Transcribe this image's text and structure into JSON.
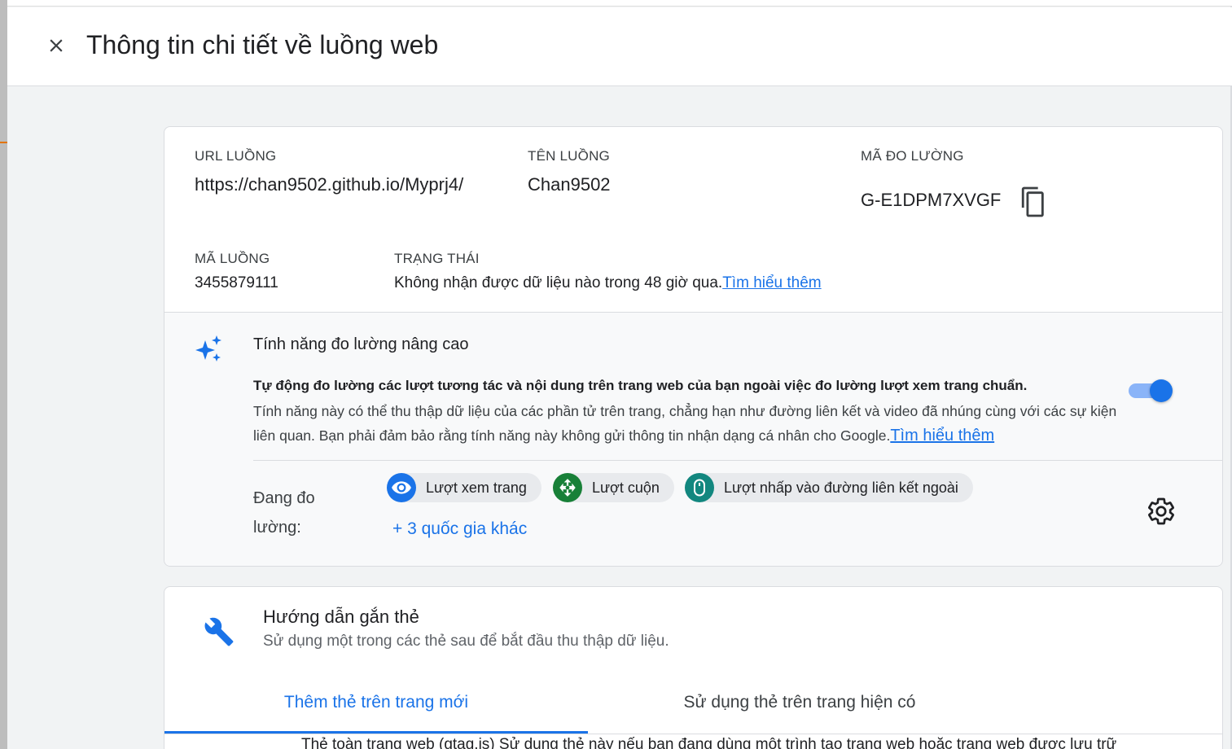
{
  "header": {
    "title": "Thông tin chi tiết về luồng web",
    "close_icon": "close-icon"
  },
  "stream_details": {
    "url_label": "URL LUỒNG",
    "url_value": "https://chan9502.github.io/Myprj4/",
    "name_label": "TÊN LUỒNG",
    "name_value": "Chan9502",
    "measurement_id_label": "MÃ ĐO LƯỜNG",
    "measurement_id_value": "G-E1DPM7XVGF",
    "stream_id_label": "MÃ LUỒNG",
    "stream_id_value": "3455879111",
    "status_label": "TRẠNG THÁI",
    "status_value": "Không nhận được dữ liệu nào trong 48 giờ qua.",
    "status_link": "Tìm hiểu thêm"
  },
  "enhanced_measurement": {
    "icon": "sparkle-icon",
    "title": "Tính năng đo lường nâng cao",
    "bold_text": "Tự động đo lường các lượt tương tác và nội dung trên trang web của bạn ngoài việc đo lường lượt xem trang chuẩn.",
    "description": "Tính năng này có thể thu thập dữ liệu của các phần tử trên trang, chẳng hạn như đường liên kết và video đã nhúng cùng với các sự kiện liên quan. Bạn phải đảm bảo rằng tính năng này không gửi thông tin nhận dạng cá nhân cho Google.",
    "learn_more": "Tìm hiểu thêm",
    "toggle_on": true,
    "measuring_label": "Đang đo lường:",
    "chips": [
      {
        "label": "Lượt xem trang",
        "icon": "eye-icon",
        "color": "#1a73e8"
      },
      {
        "label": "Lượt cuộn",
        "icon": "scroll-arrows-icon",
        "color": "#188038"
      },
      {
        "label": "Lượt nhấp vào đường liên kết ngoài",
        "icon": "mouse-icon",
        "color": "#12877f"
      }
    ],
    "more_link": "+ 3 quốc gia khác"
  },
  "tagging": {
    "icon": "wrench-icon",
    "title": "Hướng dẫn gắn thẻ",
    "subtitle": "Sử dụng một trong các thẻ sau để bắt đầu thu thập dữ liệu.",
    "tabs": [
      {
        "label": "Thêm thẻ trên trang mới",
        "active": true
      },
      {
        "label": "Sử dụng thẻ trên trang hiện có",
        "active": false
      }
    ],
    "cut_off_text": "Thẻ toàn trang web (gtag.js) Sử dụng thẻ này nếu bạn đang dùng một trình tạo trang web hoặc trang web được lưu trữ"
  },
  "colors": {
    "accent": "#1a73e8",
    "background": "#f1f3f4",
    "card": "#ffffff"
  }
}
